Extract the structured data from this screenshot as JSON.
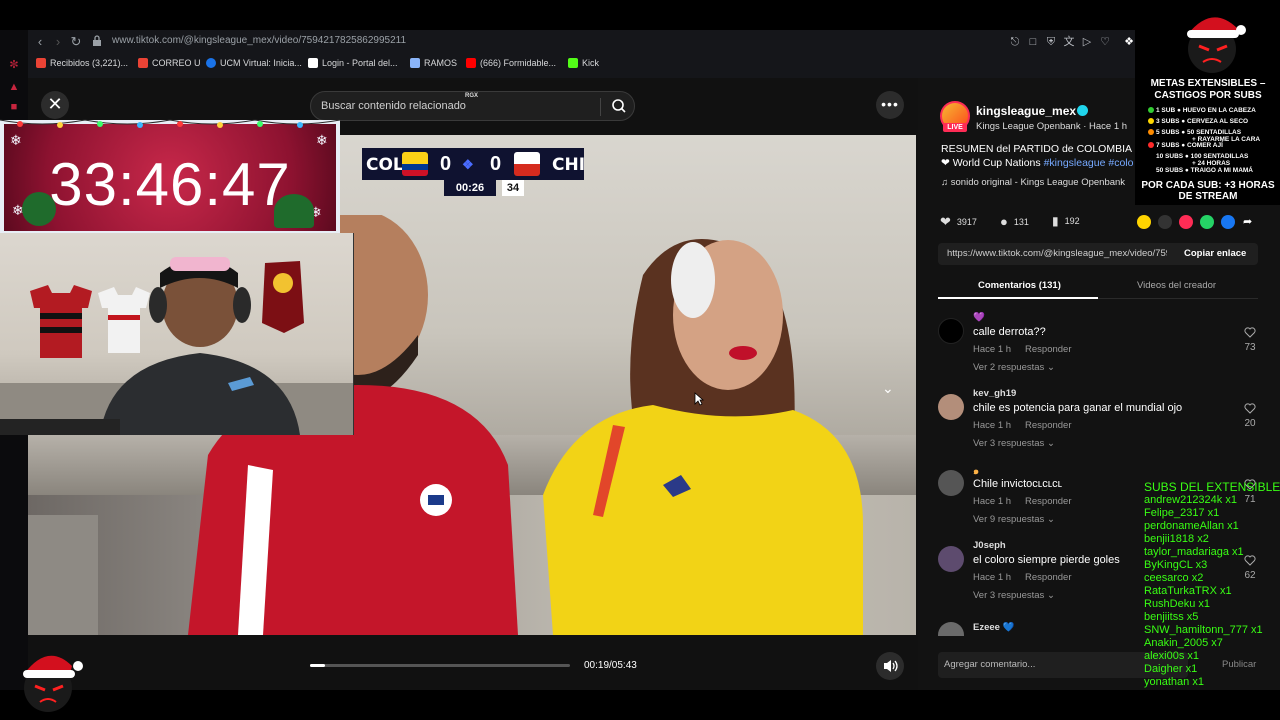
{
  "browser": {
    "url": "www.tiktok.com/@kingsleague_mex/video/7594217825862995211",
    "bookmarks": [
      {
        "label": "Recibidos (3,221)...",
        "color": "#ea4335"
      },
      {
        "label": "CORREO U",
        "color": "#ea4335"
      },
      {
        "label": "UCM Virtual: Inicia...",
        "color": "#1a73e8"
      },
      {
        "label": "Login - Portal del...",
        "color": "#ffffff"
      },
      {
        "label": "RAMOS",
        "color": "#8ab4f8"
      },
      {
        "label": "(666) Formidable...",
        "color": "#ff0000"
      },
      {
        "label": "Kick",
        "color": "#53fc18"
      }
    ]
  },
  "video_page": {
    "close_icon": "close-icon",
    "search_placeholder": "Buscar contenido relacionado",
    "rgx_badge": "RGX",
    "more_icon": "more-icon",
    "scorebug": {
      "team_left": "COL",
      "score_left": "0",
      "score_right": "0",
      "team_right": "CHI",
      "clock": "00:26",
      "shot_clock": "34"
    },
    "player": {
      "progress": 0.058,
      "timecode": "00:19/05:43"
    }
  },
  "timer_overlay": {
    "time": "33:46:47"
  },
  "side_panel": {
    "author": "kingsleague_mex",
    "live_badge": "LIVE",
    "subline": "Kings League Openbank · Hace 1 h",
    "description_plain": "RESUMEN del PARTIDO de COLOMBIA ❤ World Cup Nations ",
    "description_tags": "#kingsleague #colo",
    "sound": "sonido original - Kings League Openbank",
    "stats": {
      "likes": "3917",
      "comments": "131",
      "saves": "192"
    },
    "link": "https://www.tiktok.com/@kingsleague_mex/video/7594217825862995211",
    "copy_link": "Copiar enlace",
    "tabs": {
      "comments": "Comentarios (131)",
      "creator_videos": "Videos del creador"
    },
    "comments": [
      {
        "user": "💜",
        "text": "calle derrota??",
        "time": "Hace 1 h",
        "reply": "Responder",
        "replies": "Ver 2 respuestas",
        "likes": "73",
        "avatar": "#000000"
      },
      {
        "user": "kev_gh19",
        "text": "chile es potencia para ganar el mundial ojo",
        "time": "Hace 1 h",
        "reply": "Responder",
        "replies": "Ver 3 respuestas",
        "likes": "20",
        "avatar": "#b38e7a"
      },
      {
        "user": "๑",
        "text": "Chile invictoᴄʟᴄʟᴄʟ",
        "time": "Hace 1 h",
        "reply": "Responder",
        "replies": "Ver 9 respuestas",
        "likes": "71",
        "avatar": "#555555"
      },
      {
        "user": "J0seph",
        "text": "el coloro siempre pierde goles",
        "time": "Hace 1 h",
        "reply": "Responder",
        "replies": "Ver 3 respuestas",
        "likes": "62",
        "avatar": "#5d4b6e"
      },
      {
        "user": "Ezeee 💙",
        "text": "",
        "time": "",
        "reply": "",
        "replies": "",
        "likes": "",
        "avatar": "#6a6a6a"
      }
    ],
    "add_comment_placeholder": "Agregar comentario...",
    "publish": "Publicar"
  },
  "stream_overlay": {
    "metas_title": "METAS EXTENSIBLES – CASTIGOS POR SUBS",
    "metas": [
      {
        "goal": "1 SUB",
        "reward": "HUEVO EN LA CABEZA",
        "color": "#33cc33"
      },
      {
        "goal": "3 SUBS",
        "reward": "CERVEZA AL SECO",
        "color": "#ffd700"
      },
      {
        "goal": "5 SUBS",
        "reward": "50 SENTADILLAS",
        "color": "#ff8c00"
      },
      {
        "goal": "",
        "reward": "+ RAYARME LA CARA",
        "color": ""
      },
      {
        "goal": "7 SUBS",
        "reward": "COMER AJÍ",
        "color": "#ff2a2a"
      },
      {
        "goal": "10 SUBS",
        "reward": "100 SENTADILLAS",
        "color": ""
      },
      {
        "goal": "",
        "reward": "+ 24 HORAS",
        "color": ""
      },
      {
        "goal": "50 SUBS",
        "reward": "TRAIGO A MI MAMÁ",
        "color": ""
      }
    ],
    "por_cada_sub": "POR CADA SUB: +3 HORAS DE STREAM",
    "subs_header": "SUBS DEL EXTENSIBLE:",
    "subs": [
      "andrew212324k x1",
      "Felipe_2317 x1",
      "perdonameAllan x1",
      "benjii1818 x2",
      "taylor_madariaga x1",
      "ByKingCL x3",
      "ceesarco x2",
      "RataTurkaTRX x1",
      "RushDeku x1",
      "benjiitss x5",
      "SNW_hamiltonn_777 x1",
      "Anakin_2005 x7",
      "alexi00s x1",
      "Daigher x1",
      "yonathan x1"
    ]
  }
}
